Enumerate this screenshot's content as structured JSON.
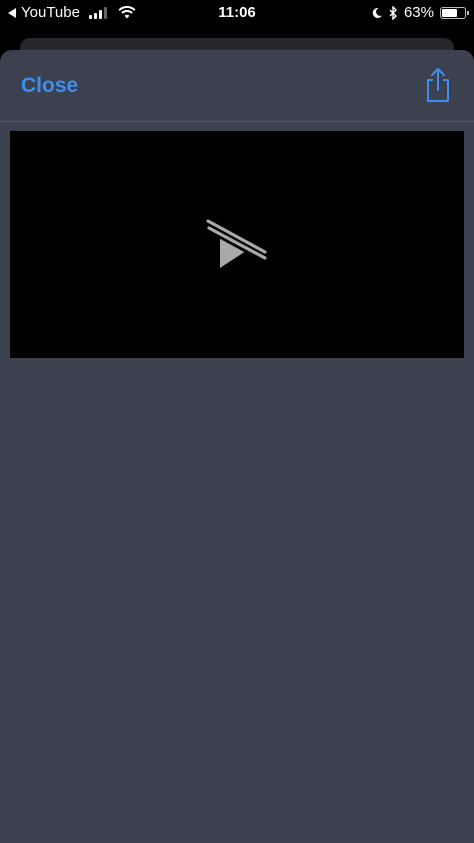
{
  "status_bar": {
    "back_app": "YouTube",
    "time": "11:06",
    "battery_percent": "63%",
    "battery_level": 0.63,
    "icons": [
      "back-caret-icon",
      "signal-icon",
      "wifi-icon",
      "moon-icon",
      "bluetooth-icon",
      "battery-icon"
    ]
  },
  "sheet": {
    "close_label": "Close",
    "share_icon": "share-icon"
  },
  "video": {
    "state_icon": "play-disabled-icon"
  },
  "colors": {
    "accent": "#3d8ef0",
    "sheet_bg": "#3b414f",
    "video_bg": "#000000"
  }
}
